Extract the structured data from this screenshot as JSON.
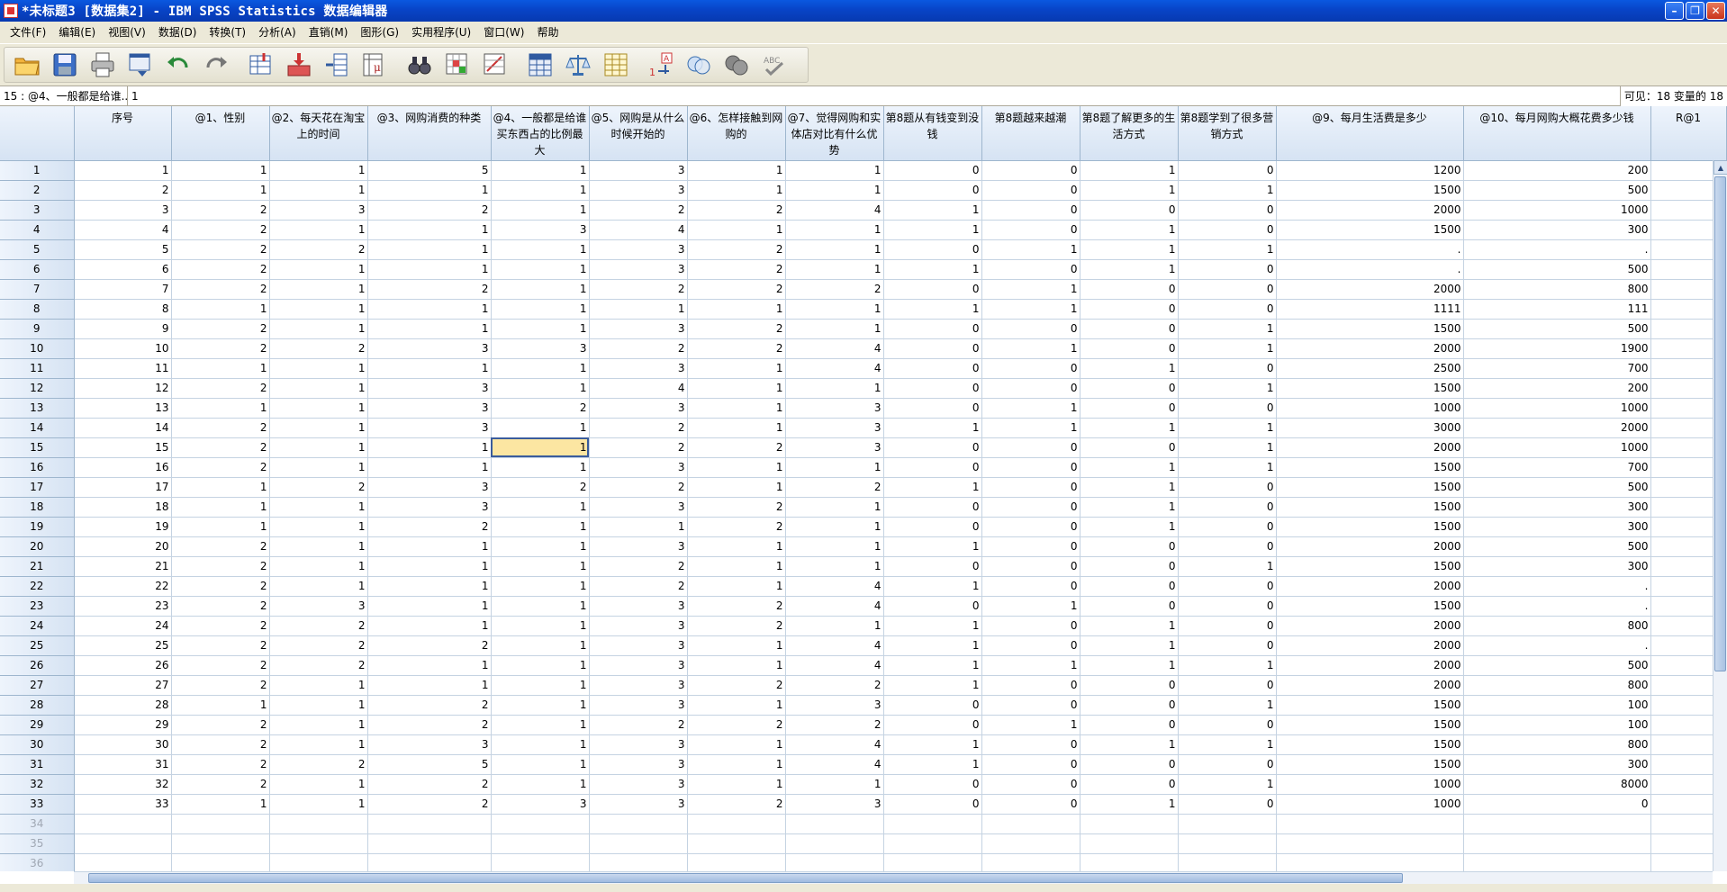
{
  "window": {
    "title": "*未标题3 [数据集2] - IBM SPSS Statistics 数据编辑器"
  },
  "menu": [
    "文件(F)",
    "编辑(E)",
    "视图(V)",
    "数据(D)",
    "转换(T)",
    "分析(A)",
    "直销(M)",
    "图形(G)",
    "实用程序(U)",
    "窗口(W)",
    "帮助"
  ],
  "editbar": {
    "cell_ref": "15 : @4、一般都是给谁...",
    "cell_value": "1",
    "visible_info": "可见：18 变量的 18"
  },
  "columns": [
    "序号",
    "@1、性别",
    "@2、每天花在淘宝上的时间",
    "@3、网购消费的种类",
    "@4、一般都是给谁买东西占的比例最大",
    "@5、网购是从什么时候开始的",
    "@6、怎样接触到网购的",
    "@7、觉得网购和实体店对比有什么优势",
    "第8题从有钱变到没钱",
    "第8题越来越潮",
    "第8题了解更多的生活方式",
    "第8题学到了很多营销方式",
    "@9、每月生活费是多少",
    "@10、每月网购大概花费多少钱",
    "R@1"
  ],
  "rows": [
    [
      "1",
      "1",
      "1",
      "5",
      "1",
      "3",
      "1",
      "1",
      "0",
      "0",
      "1",
      "0",
      "1200",
      "200"
    ],
    [
      "2",
      "1",
      "1",
      "1",
      "1",
      "3",
      "1",
      "1",
      "0",
      "0",
      "1",
      "1",
      "1500",
      "500"
    ],
    [
      "3",
      "2",
      "3",
      "2",
      "1",
      "2",
      "2",
      "4",
      "1",
      "0",
      "0",
      "0",
      "2000",
      "1000"
    ],
    [
      "4",
      "2",
      "1",
      "1",
      "3",
      "4",
      "1",
      "1",
      "1",
      "0",
      "1",
      "0",
      "1500",
      "300"
    ],
    [
      "5",
      "2",
      "2",
      "1",
      "1",
      "3",
      "2",
      "1",
      "0",
      "1",
      "1",
      "1",
      ".",
      "."
    ],
    [
      "6",
      "2",
      "1",
      "1",
      "1",
      "3",
      "2",
      "1",
      "1",
      "0",
      "1",
      "0",
      ".",
      "500"
    ],
    [
      "7",
      "2",
      "1",
      "2",
      "1",
      "2",
      "2",
      "2",
      "0",
      "1",
      "0",
      "0",
      "2000",
      "800"
    ],
    [
      "8",
      "1",
      "1",
      "1",
      "1",
      "1",
      "1",
      "1",
      "1",
      "1",
      "0",
      "0",
      "1111",
      "111"
    ],
    [
      "9",
      "2",
      "1",
      "1",
      "1",
      "3",
      "2",
      "1",
      "0",
      "0",
      "0",
      "1",
      "1500",
      "500"
    ],
    [
      "10",
      "2",
      "2",
      "3",
      "3",
      "2",
      "2",
      "4",
      "0",
      "1",
      "0",
      "1",
      "2000",
      "1900"
    ],
    [
      "11",
      "1",
      "1",
      "1",
      "1",
      "3",
      "1",
      "4",
      "0",
      "0",
      "1",
      "0",
      "2500",
      "700"
    ],
    [
      "12",
      "2",
      "1",
      "3",
      "1",
      "4",
      "1",
      "1",
      "0",
      "0",
      "0",
      "1",
      "1500",
      "200"
    ],
    [
      "13",
      "1",
      "1",
      "3",
      "2",
      "3",
      "1",
      "3",
      "0",
      "1",
      "0",
      "0",
      "1000",
      "1000"
    ],
    [
      "14",
      "2",
      "1",
      "3",
      "1",
      "2",
      "1",
      "3",
      "1",
      "1",
      "1",
      "1",
      "3000",
      "2000"
    ],
    [
      "15",
      "2",
      "1",
      "1",
      "1",
      "2",
      "2",
      "3",
      "0",
      "0",
      "0",
      "1",
      "2000",
      "1000"
    ],
    [
      "16",
      "2",
      "1",
      "1",
      "1",
      "3",
      "1",
      "1",
      "0",
      "0",
      "1",
      "1",
      "1500",
      "700"
    ],
    [
      "17",
      "1",
      "2",
      "3",
      "2",
      "2",
      "1",
      "2",
      "1",
      "0",
      "1",
      "0",
      "1500",
      "500"
    ],
    [
      "18",
      "1",
      "1",
      "3",
      "1",
      "3",
      "2",
      "1",
      "0",
      "0",
      "1",
      "0",
      "1500",
      "300"
    ],
    [
      "19",
      "1",
      "1",
      "2",
      "1",
      "1",
      "2",
      "1",
      "0",
      "0",
      "1",
      "0",
      "1500",
      "300"
    ],
    [
      "20",
      "2",
      "1",
      "1",
      "1",
      "3",
      "1",
      "1",
      "1",
      "0",
      "0",
      "0",
      "2000",
      "500"
    ],
    [
      "21",
      "2",
      "1",
      "1",
      "1",
      "2",
      "1",
      "1",
      "0",
      "0",
      "0",
      "1",
      "1500",
      "300"
    ],
    [
      "22",
      "2",
      "1",
      "1",
      "1",
      "2",
      "1",
      "4",
      "1",
      "0",
      "0",
      "0",
      "2000",
      "."
    ],
    [
      "23",
      "2",
      "3",
      "1",
      "1",
      "3",
      "2",
      "4",
      "0",
      "1",
      "0",
      "0",
      "1500",
      "."
    ],
    [
      "24",
      "2",
      "2",
      "1",
      "1",
      "3",
      "2",
      "1",
      "1",
      "0",
      "1",
      "0",
      "2000",
      "800"
    ],
    [
      "25",
      "2",
      "2",
      "2",
      "1",
      "3",
      "1",
      "4",
      "1",
      "0",
      "1",
      "0",
      "2000",
      "."
    ],
    [
      "26",
      "2",
      "2",
      "1",
      "1",
      "3",
      "1",
      "4",
      "1",
      "1",
      "1",
      "1",
      "2000",
      "500"
    ],
    [
      "27",
      "2",
      "1",
      "1",
      "1",
      "3",
      "2",
      "2",
      "1",
      "0",
      "0",
      "0",
      "2000",
      "800"
    ],
    [
      "28",
      "1",
      "1",
      "2",
      "1",
      "3",
      "1",
      "3",
      "0",
      "0",
      "0",
      "1",
      "1500",
      "100"
    ],
    [
      "29",
      "2",
      "1",
      "2",
      "1",
      "2",
      "2",
      "2",
      "0",
      "1",
      "0",
      "0",
      "1500",
      "100"
    ],
    [
      "30",
      "2",
      "1",
      "3",
      "1",
      "3",
      "1",
      "4",
      "1",
      "0",
      "1",
      "1",
      "1500",
      "800"
    ],
    [
      "31",
      "2",
      "2",
      "5",
      "1",
      "3",
      "1",
      "4",
      "1",
      "0",
      "0",
      "0",
      "1500",
      "300"
    ],
    [
      "32",
      "2",
      "1",
      "2",
      "1",
      "3",
      "1",
      "1",
      "0",
      "0",
      "0",
      "1",
      "1000",
      "8000"
    ],
    [
      "33",
      "1",
      "1",
      "2",
      "3",
      "3",
      "2",
      "3",
      "0",
      "0",
      "1",
      "0",
      "1000",
      "0"
    ]
  ],
  "empty_rows": [
    "34",
    "35",
    "36"
  ],
  "selected_cell": {
    "row": 15,
    "col": 4
  },
  "icons": [
    "open-folder-icon",
    "save-icon",
    "print-icon",
    "recall-dialog-icon",
    "undo-icon",
    "redo-icon",
    "goto-case-icon",
    "goto-variable-icon",
    "variables-icon",
    "run-descriptives-icon",
    "find-icon",
    "insert-cases-icon",
    "insert-variable-icon",
    "split-file-icon",
    "weight-cases-icon",
    "select-cases-icon",
    "value-labels-icon",
    "use-sets-icon",
    "show-all-icon",
    "spell-check-icon"
  ],
  "colors": {
    "title_bar": "#0844c7",
    "header_bg": "#d6e3f3",
    "selected_cell": "#fce6a2",
    "chrome": "#ece9d8"
  }
}
